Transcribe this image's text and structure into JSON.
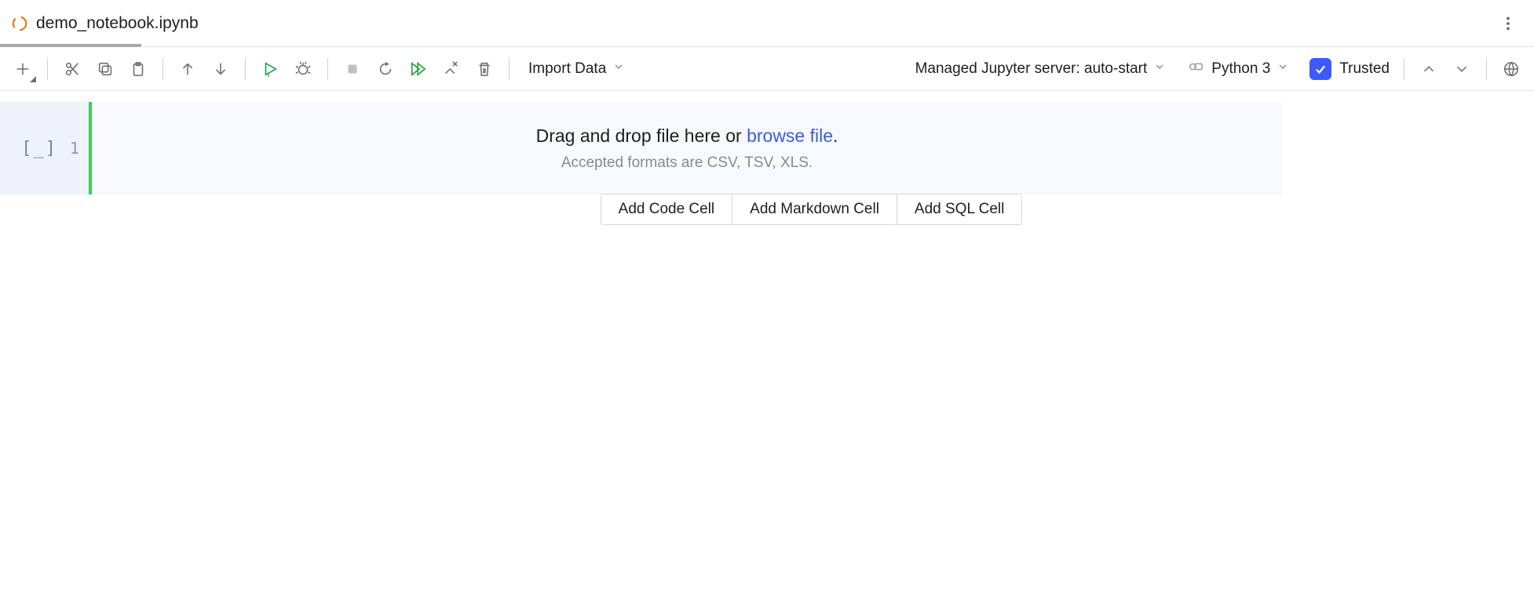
{
  "tab": {
    "filename": "demo_notebook.ipynb"
  },
  "toolbar": {
    "import_data": "Import Data",
    "server_label": "Managed Jupyter server: auto-start",
    "kernel_label": "Python 3",
    "trusted": "Trusted"
  },
  "dropzone": {
    "prompt_prefix": "Drag and drop file here or ",
    "browse_link": "browse file",
    "prompt_suffix": ".",
    "accepted": "Accepted formats are CSV, TSV, XLS."
  },
  "cell_buttons": {
    "code": "Add Code Cell",
    "markdown": "Add Markdown Cell",
    "sql": "Add SQL Cell"
  },
  "cell": {
    "exec_bracket": "[_]",
    "lineno": "1"
  }
}
